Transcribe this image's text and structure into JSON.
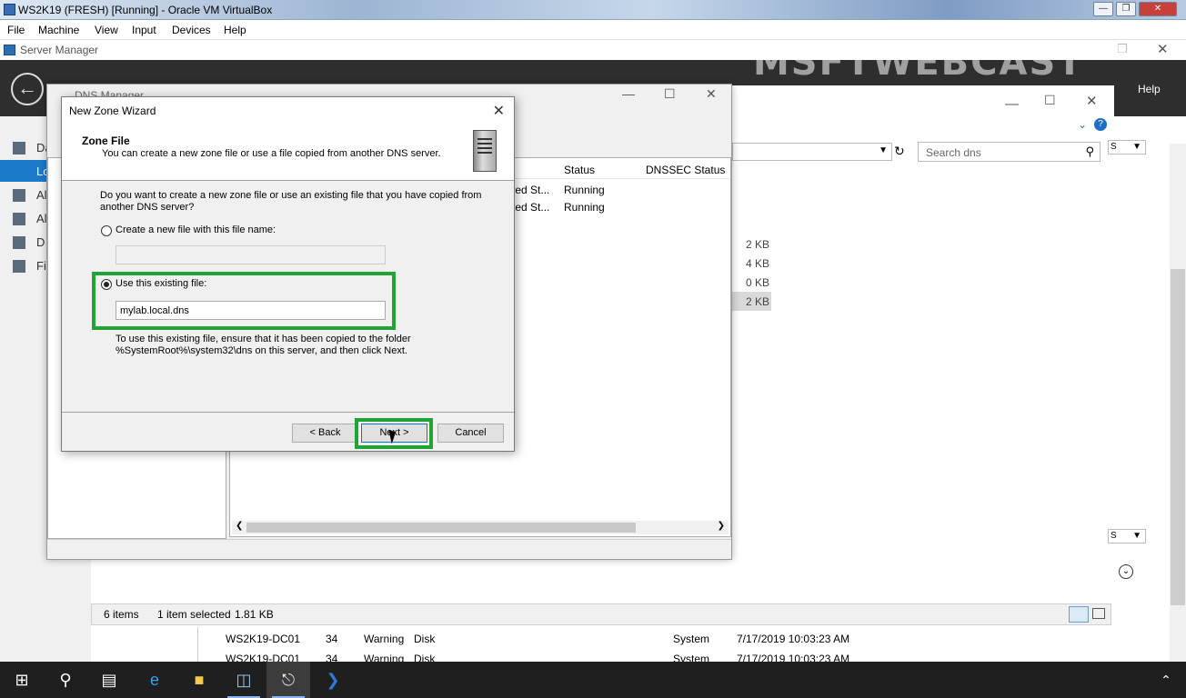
{
  "vbox": {
    "title": "WS2K19 (FRESH) [Running] - Oracle VM VirtualBox",
    "menu": [
      "File",
      "Machine",
      "View",
      "Input",
      "Devices",
      "Help"
    ]
  },
  "server_manager": {
    "title": "Server Manager",
    "help": "Help",
    "watermark": "MSFTWEBCAST",
    "sidebar": [
      "Da",
      "Lo",
      "Al",
      "Al",
      "D",
      "Fi"
    ],
    "search_placeholder": "Search dns",
    "sizes": [
      "2 KB",
      "4 KB",
      "0 KB",
      "2 KB"
    ],
    "footer": {
      "items": "6 items",
      "selected": "1 item selected",
      "size": "1.81 KB"
    },
    "events": [
      [
        "WS2K19-DC01",
        "34",
        "Warning",
        "Disk",
        "System",
        "7/17/2019 10:03:23 AM"
      ],
      [
        "WS2K19-DC01",
        "34",
        "Warning",
        "Disk",
        "System",
        "7/17/2019 10:03:23 AM"
      ]
    ]
  },
  "dns_manager": {
    "title": "DNS Manager",
    "columns": [
      "Status",
      "DNSSEC Status"
    ],
    "rows": [
      {
        "type": "ted St...",
        "status": "Running"
      },
      {
        "type": "ted St...",
        "status": "Running"
      }
    ]
  },
  "wizard": {
    "title": "New Zone Wizard",
    "header_title": "Zone File",
    "header_subtitle": "You can create a new zone file or use a file copied from another DNS server.",
    "question": "Do you want to create a new zone file or use an existing file that you have copied from another DNS server?",
    "option_new": "Create a new file with this file name:",
    "new_file_value": "",
    "option_existing": "Use this existing file:",
    "existing_file_value": "mylab.local.dns",
    "note": "To use this existing file, ensure that it has been copied to the folder %SystemRoot%\\system32\\dns on this server, and then click Next.",
    "back": "< Back",
    "next": "Next >",
    "cancel": "Cancel",
    "selected_option": "existing"
  },
  "highlight_color": "#21a336"
}
